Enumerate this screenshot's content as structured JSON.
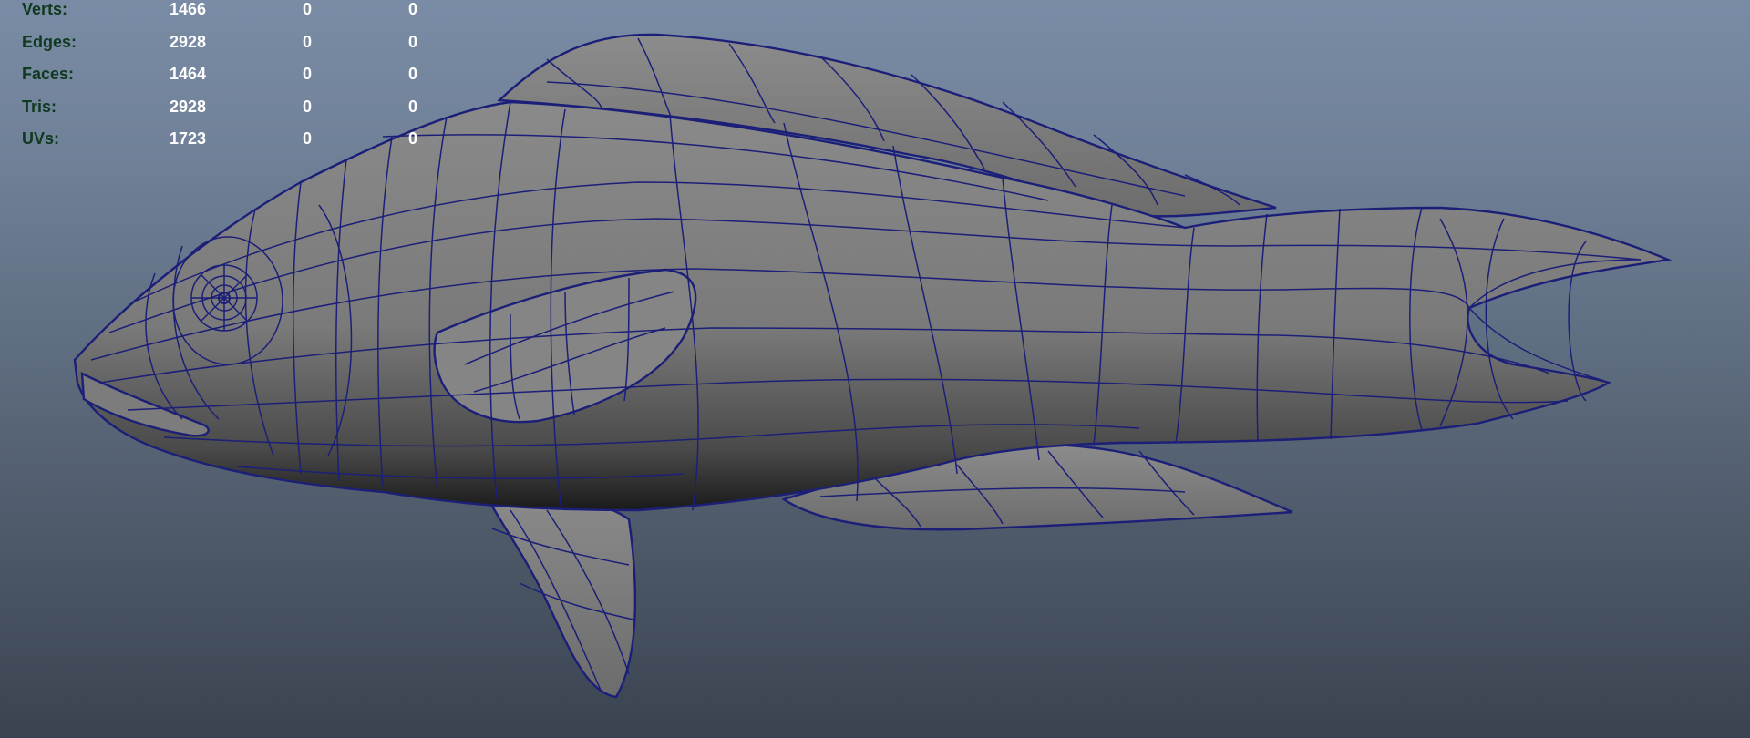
{
  "viewport": {
    "background_top": "#7a8ca5",
    "background_bottom": "#3a4350",
    "mesh_fill": "#7d7d7d",
    "wire_color": "#1c1f78"
  },
  "hud": {
    "label_color": "#0f3a1f",
    "value_color": "#ffffff",
    "rows": [
      {
        "label": "Verts:",
        "v1": "1466",
        "v2": "0",
        "v3": "0"
      },
      {
        "label": "Edges:",
        "v1": "2928",
        "v2": "0",
        "v3": "0"
      },
      {
        "label": "Faces:",
        "v1": "1464",
        "v2": "0",
        "v3": "0"
      },
      {
        "label": "Tris:",
        "v1": "2928",
        "v2": "0",
        "v3": "0"
      },
      {
        "label": "UVs:",
        "v1": "1723",
        "v2": "0",
        "v3": "0"
      }
    ]
  }
}
